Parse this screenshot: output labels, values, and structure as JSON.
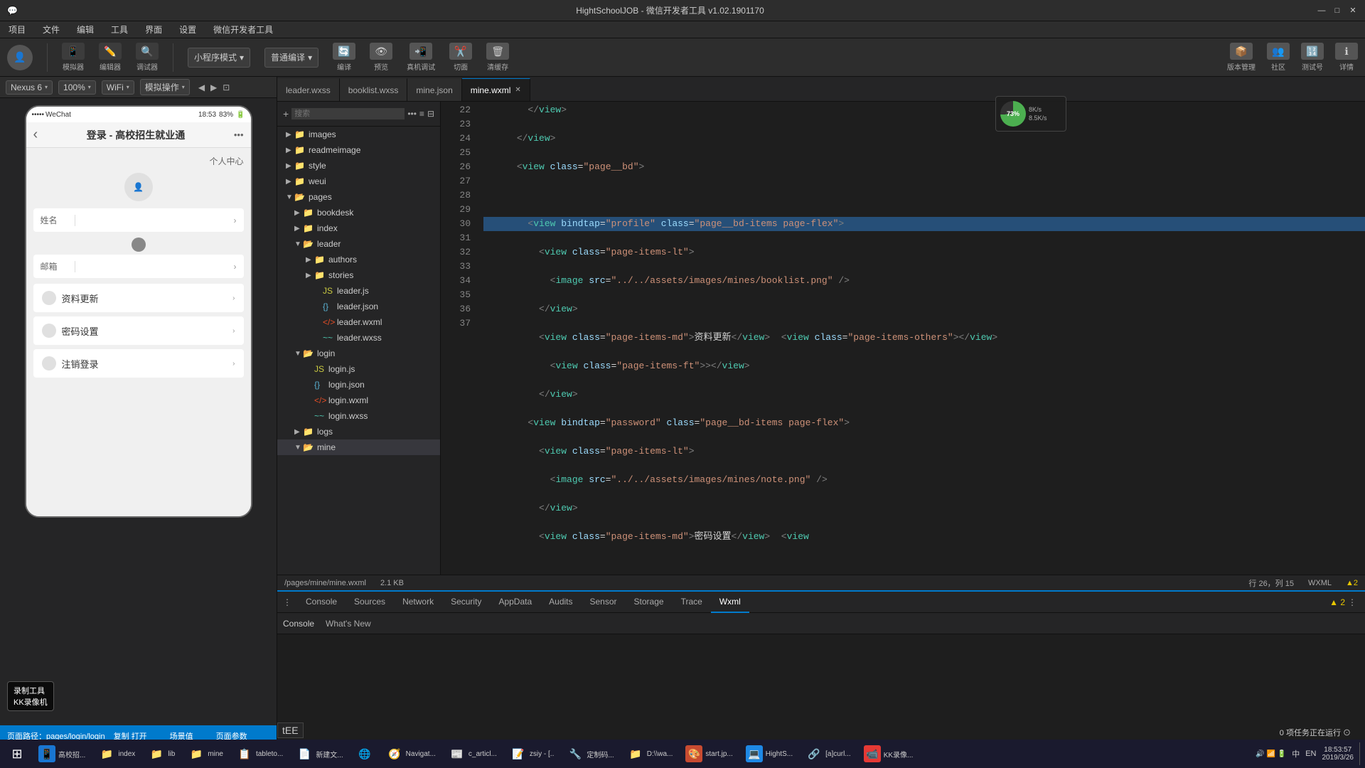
{
  "window": {
    "title": "HightSchoolJOB - 微信开发者工具 v1.02.1901170",
    "min": "—",
    "max": "□",
    "close": "✕"
  },
  "menu": {
    "items": [
      "项目",
      "文件",
      "编辑",
      "工具",
      "界面",
      "设置",
      "微信开发者工具"
    ]
  },
  "toolbar": {
    "simulator_label": "模拟器",
    "editor_label": "编辑器",
    "debugger_label": "调试器",
    "mode_label": "小程序模式",
    "compile_label": "普通编译",
    "upload_label": "编译",
    "preview_label": "预览",
    "device_label": "真机调试",
    "cut_label": "切面",
    "clear_label": "清缓存",
    "version_label": "版本管理",
    "community_label": "社区",
    "test_label": "测试号",
    "detail_label": "详情"
  },
  "device_bar": {
    "nexus": "Nexus 6",
    "zoom": "100%",
    "wifi": "WiFi",
    "simulate": "模拟操作",
    "icons": [
      "◀",
      "▶",
      "⊡"
    ]
  },
  "phone": {
    "status_dots": "•••••",
    "carrier": "WeChat",
    "time": "18:53",
    "battery": "83%",
    "nav_back": "‹",
    "page_title": "登录 - 高校招生就业通",
    "nav_more": "•••",
    "section_title": "个人中心",
    "form_name_label": "姓名",
    "form_email_label": "邮箱",
    "menu_items": [
      "资料更新",
      "密码设置",
      "注销登录"
    ],
    "recording_label": "录制工具\nKK录像机"
  },
  "file_tree": {
    "search_placeholder": "搜索",
    "items": [
      {
        "indent": 0,
        "type": "folder",
        "name": "images",
        "open": true
      },
      {
        "indent": 0,
        "type": "folder",
        "name": "readmeimage",
        "open": false
      },
      {
        "indent": 0,
        "type": "folder",
        "name": "style",
        "open": false
      },
      {
        "indent": 0,
        "type": "folder",
        "name": "weui",
        "open": false
      },
      {
        "indent": 0,
        "type": "folder",
        "name": "pages",
        "open": true
      },
      {
        "indent": 1,
        "type": "folder",
        "name": "bookdesk",
        "open": false
      },
      {
        "indent": 1,
        "type": "folder",
        "name": "index",
        "open": false
      },
      {
        "indent": 1,
        "type": "folder",
        "name": "leader",
        "open": true
      },
      {
        "indent": 2,
        "type": "folder",
        "name": "authors",
        "open": false
      },
      {
        "indent": 2,
        "type": "folder",
        "name": "stories",
        "open": false
      },
      {
        "indent": 2,
        "type": "js",
        "name": "leader.js"
      },
      {
        "indent": 2,
        "type": "json",
        "name": "leader.json"
      },
      {
        "indent": 2,
        "type": "wxml",
        "name": "leader.wxml"
      },
      {
        "indent": 2,
        "type": "wxss",
        "name": "leader.wxss"
      },
      {
        "indent": 1,
        "type": "folder",
        "name": "login",
        "open": true
      },
      {
        "indent": 2,
        "type": "js",
        "name": "login.js"
      },
      {
        "indent": 2,
        "type": "json",
        "name": "login.json"
      },
      {
        "indent": 2,
        "type": "wxml",
        "name": "login.wxml"
      },
      {
        "indent": 2,
        "type": "wxss",
        "name": "login.wxss"
      },
      {
        "indent": 1,
        "type": "folder",
        "name": "logs",
        "open": false
      },
      {
        "indent": 1,
        "type": "folder",
        "name": "mine",
        "open": true,
        "selected": true
      }
    ]
  },
  "editor_tabs": [
    {
      "label": "leader.wxss",
      "active": false
    },
    {
      "label": "booklist.wxss",
      "active": false
    },
    {
      "label": "mine.json",
      "active": false
    },
    {
      "label": "mine.wxml",
      "active": true,
      "closeable": true
    }
  ],
  "code": {
    "filepath": "/pages/mine/mine.wxml",
    "filesize": "2.1 KB",
    "cursor": "行 26，列 15",
    "format": "WXML",
    "lines": [
      {
        "num": 22,
        "content": "        </view>"
      },
      {
        "num": 23,
        "content": "      </view>"
      },
      {
        "num": 24,
        "content": "      <view class=\"page__bd\">"
      },
      {
        "num": 25,
        "content": ""
      },
      {
        "num": 26,
        "content": "        <view bindtap=\"profile\" class=\"page__bd-items page-flex\">",
        "highlight": true
      },
      {
        "num": 27,
        "content": "          <view class=\"page-items-lt\">"
      },
      {
        "num": 28,
        "content": "            <image src=\"../../assets/images/mines/booklist.png\" />"
      },
      {
        "num": 29,
        "content": "          </view>"
      },
      {
        "num": 30,
        "content": "          <view class=\"page-items-md\">资料更新</view>  <view class=\"page-items-others\"></view>"
      },
      {
        "num": 31,
        "content": "            <view class=\"page-items-ft\">></view>"
      },
      {
        "num": 32,
        "content": "          </view>"
      },
      {
        "num": 33,
        "content": "        <view bindtap=\"password\" class=\"page__bd-items page-flex\">"
      },
      {
        "num": 34,
        "content": "          <view class=\"page-items-lt\">"
      },
      {
        "num": 35,
        "content": "            <image src=\"../../assets/images/mines/note.png\" />"
      },
      {
        "num": 36,
        "content": "          </view>"
      },
      {
        "num": 37,
        "content": "          <view class=\"page-items-md\">密码设置</view>  <view"
      }
    ]
  },
  "debug_panel": {
    "tabs": [
      "Console",
      "Sources",
      "Network",
      "Security",
      "AppData",
      "Audits",
      "Sensor",
      "Storage",
      "Trace",
      "Wxml"
    ],
    "active_tab": "Wxml",
    "console_tab": "Console",
    "whats_new_tab": "What's New",
    "errors": "▲ 2",
    "bottom_left_label": "tEE"
  },
  "editor_info": {
    "warnings": "▲2",
    "cursor_pos": "行 26，列 15",
    "format": "WXML"
  },
  "perf": {
    "percent": "73%",
    "upload": "8K/s",
    "download": "8.5K/s"
  },
  "bottom_status": {
    "path": "页面路径：pages/login/login",
    "compile": "复制  打开",
    "params_label": "场景值",
    "page_params": "页面参数"
  },
  "taskbar": {
    "start_icon": "⊞",
    "items": [
      {
        "label": "高校招...",
        "icon": "📱"
      },
      {
        "label": "index",
        "icon": "📁"
      },
      {
        "label": "lib",
        "icon": "📁"
      },
      {
        "label": "mine",
        "icon": "📁"
      },
      {
        "label": "tableto...",
        "icon": "📋"
      },
      {
        "label": "新建文...",
        "icon": "📄"
      },
      {
        "label": "",
        "icon": "🌐"
      },
      {
        "label": "Navigat...",
        "icon": "🧭"
      },
      {
        "label": "c_articl...",
        "icon": "📰"
      },
      {
        "label": "zsiy - [..",
        "icon": "📝"
      },
      {
        "label": "定制码...",
        "icon": "🔧"
      },
      {
        "label": "D:\\wa...",
        "icon": "📁"
      },
      {
        "label": "start.jp...",
        "icon": "🎨"
      },
      {
        "label": "HightS...",
        "icon": "💻"
      },
      {
        "label": "[a]curl...",
        "icon": "🔗"
      },
      {
        "label": "KK录像...",
        "icon": "📹"
      }
    ],
    "time": "18:53:57",
    "date": "2019/3/26"
  }
}
